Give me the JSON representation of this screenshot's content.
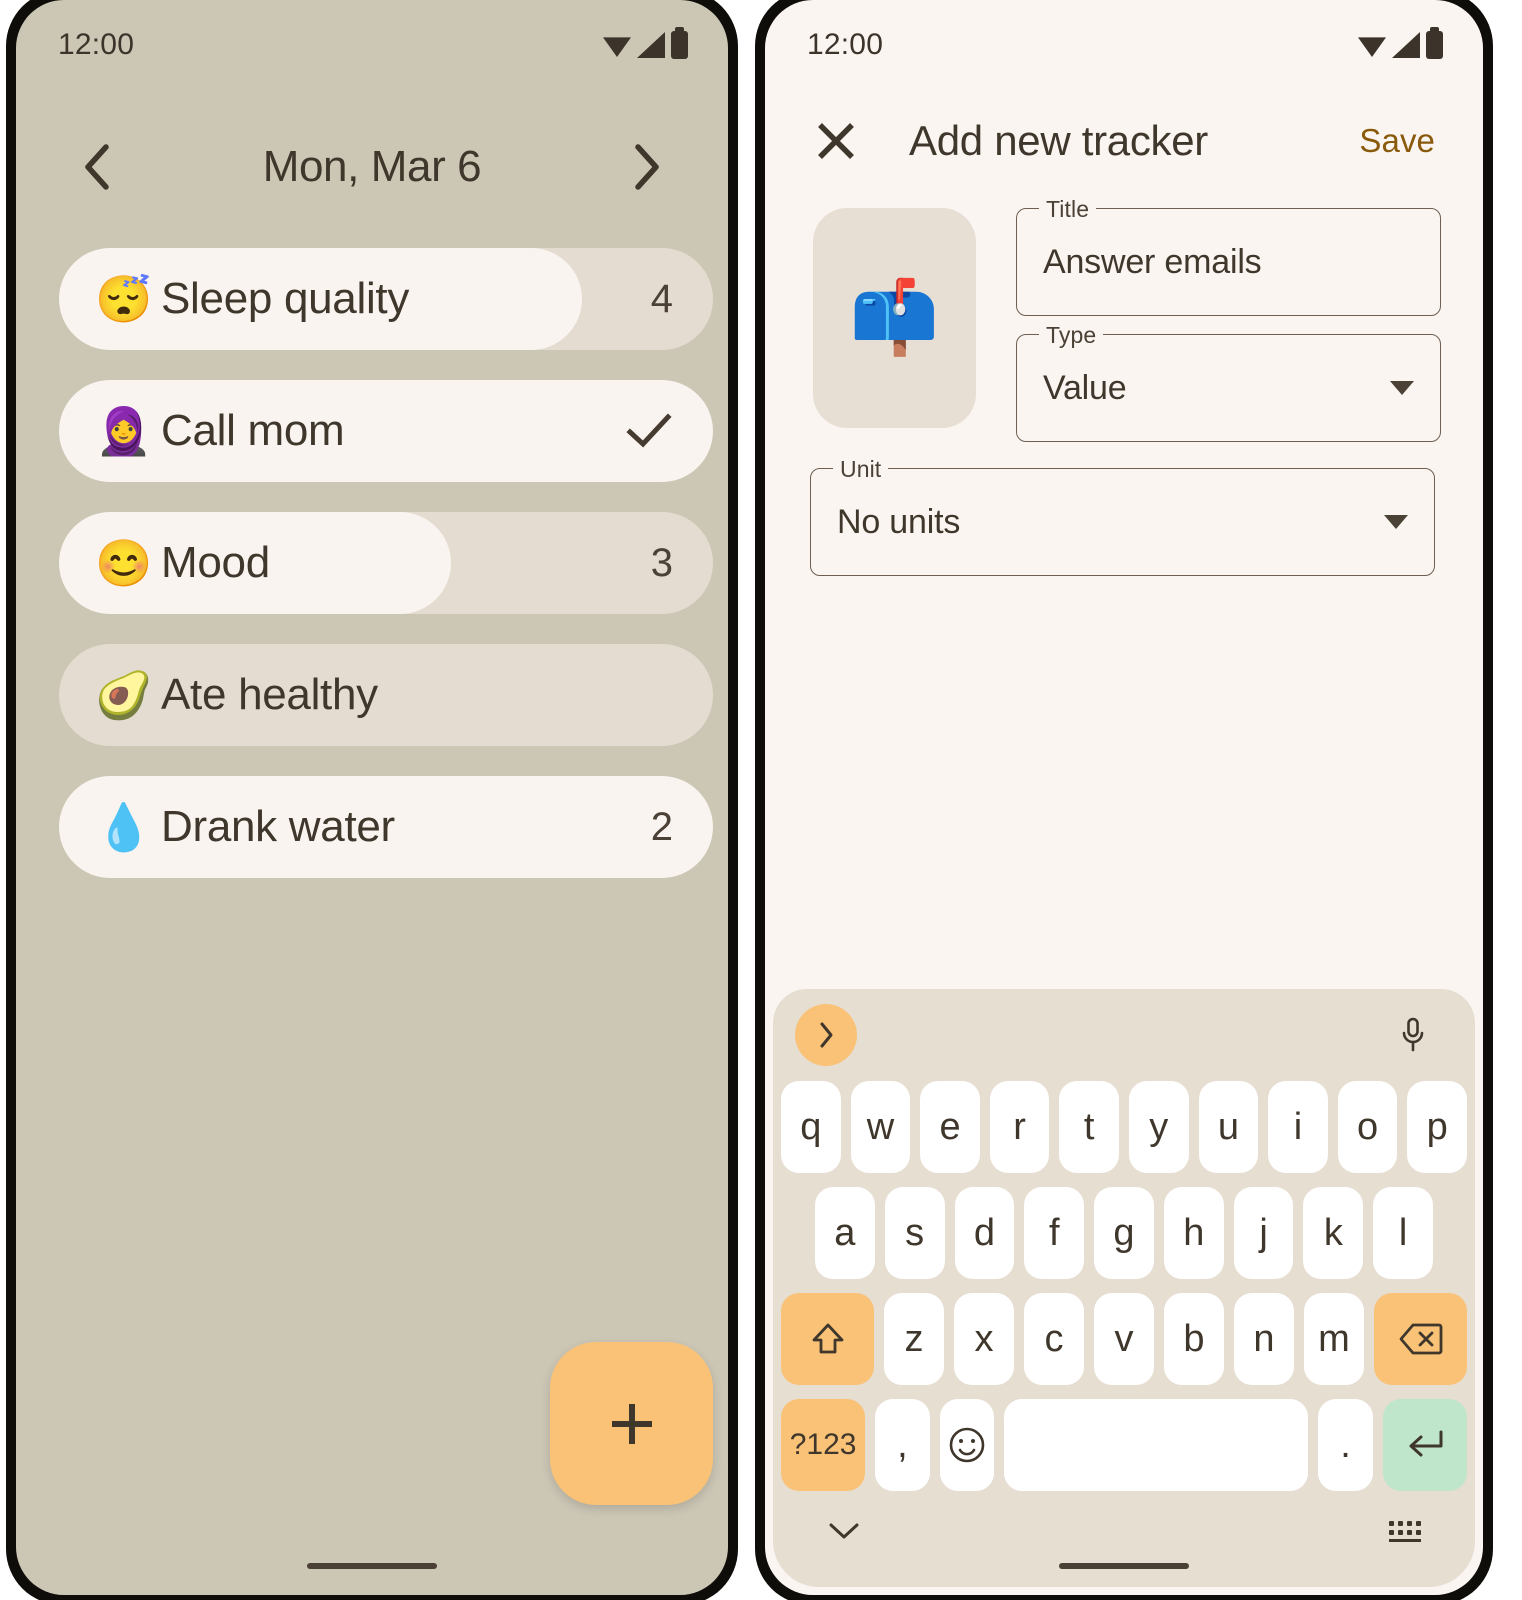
{
  "left_phone": {
    "status_bar": {
      "time": "12:00",
      "icons": [
        "wifi-icon",
        "signal-icon",
        "battery-icon"
      ]
    },
    "date_header": {
      "prev_label": "chevron-left-icon",
      "title": "Mon, Mar 6",
      "next_label": "chevron-right-icon"
    },
    "trackers": [
      {
        "emoji": "😴",
        "emoji_name": "sleeping-face-emoji",
        "label": "Sleep quality",
        "value": "4",
        "fill_percent": 80,
        "checked": false
      },
      {
        "emoji": "🧕",
        "emoji_name": "woman-with-headscarf-emoji",
        "label": "Call mom",
        "value": "",
        "fill_percent": 100,
        "checked": true
      },
      {
        "emoji": "😊",
        "emoji_name": "smiling-face-emoji",
        "label": "Mood",
        "value": "3",
        "fill_percent": 60,
        "checked": false
      },
      {
        "emoji": "🥑",
        "emoji_name": "avocado-emoji",
        "label": "Ate healthy",
        "value": "",
        "fill_percent": 0,
        "checked": false
      },
      {
        "emoji": "💧",
        "emoji_name": "droplet-emoji",
        "label": "Drank water",
        "value": "2",
        "fill_percent": 100,
        "checked": false
      }
    ],
    "fab": {
      "label": "+",
      "name": "add-tracker-fab"
    }
  },
  "right_phone": {
    "status_bar": {
      "time": "12:00",
      "icons": [
        "wifi-icon",
        "signal-icon",
        "battery-icon"
      ]
    },
    "app_bar": {
      "close_label": "close-icon",
      "title": "Add new tracker",
      "save_label": "Save"
    },
    "form": {
      "emoji": "📫",
      "emoji_name": "mailbox-emoji",
      "title_field": {
        "label": "Title",
        "value": "Answer emails"
      },
      "type_field": {
        "label": "Type",
        "value": "Value"
      },
      "unit_field": {
        "label": "Unit",
        "value": "No units"
      }
    },
    "keyboard": {
      "expand_icon": "chevron-right-icon",
      "mic_icon": "microphone-icon",
      "row1": [
        "q",
        "w",
        "e",
        "r",
        "t",
        "y",
        "u",
        "i",
        "o",
        "p"
      ],
      "row2": [
        "a",
        "s",
        "d",
        "f",
        "g",
        "h",
        "j",
        "k",
        "l"
      ],
      "row3": [
        "z",
        "x",
        "c",
        "v",
        "b",
        "n",
        "m"
      ],
      "shift_label": "shift-icon",
      "backspace_label": "backspace-icon",
      "symbols_label": "?123",
      "comma_label": ",",
      "emoji_key_label": "emoji-icon",
      "space_label": "",
      "period_label": ".",
      "enter_label": "enter-icon",
      "hide_icon": "chevron-down-icon",
      "switcher_icon": "keyboard-switch-icon"
    }
  },
  "colors": {
    "left_bg": "#ccc6b5",
    "right_bg": "#fbf5f1",
    "track": "#e4dcd1",
    "fill": "#f9f4ef",
    "accent_orange": "#f9c277",
    "enter_green": "#bfe6ca",
    "save_gold": "#8a5a0c",
    "text_dark": "#3f372c"
  }
}
